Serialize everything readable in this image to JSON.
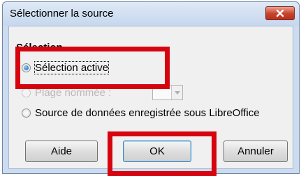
{
  "dialog": {
    "title": "Sélectionner la source",
    "close_icon": "close-x-icon"
  },
  "selection": {
    "label": "Sélection",
    "options": [
      {
        "label": "Sélection active",
        "checked": true,
        "enabled": true,
        "mnemonic": "a"
      },
      {
        "label": "Plage nommée :",
        "checked": false,
        "enabled": false,
        "mnemonic": "P"
      },
      {
        "label": "Source de données enregistrée sous LibreOffice",
        "checked": false,
        "enabled": true,
        "mnemonic": "S"
      }
    ],
    "named_range_value": ""
  },
  "buttons": {
    "help": "Aide",
    "ok": "OK",
    "cancel": "Annuler"
  },
  "colors": {
    "highlight": "#d6040f",
    "close_button": "#c7412b",
    "radio_selected": "#0b57b7"
  }
}
